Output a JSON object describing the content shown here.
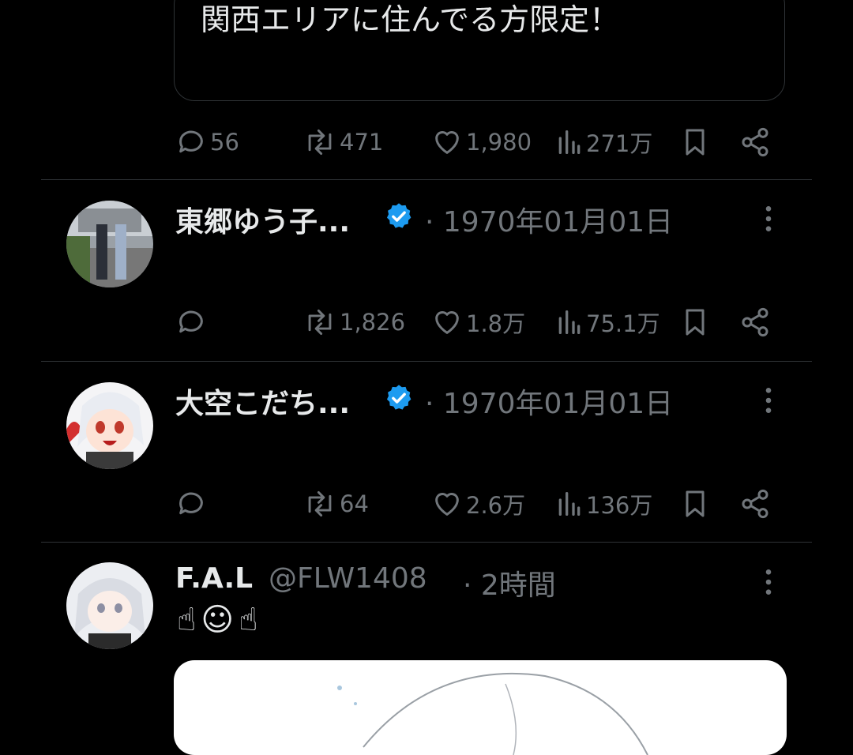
{
  "quote": {
    "text": "関西エリアに住んでる方限定！"
  },
  "tweets": [
    {
      "stats": {
        "replies": "56",
        "retweets": "471",
        "likes": "1,980",
        "views": "271万"
      }
    },
    {
      "name": "東郷ゆう子...",
      "date": "· 1970年01月01日",
      "stats": {
        "replies": "",
        "retweets": "1,826",
        "likes": "1.8万",
        "views": "75.1万"
      }
    },
    {
      "name": "大空こだち...",
      "date": "· 1970年01月01日",
      "stats": {
        "replies": "",
        "retweets": "64",
        "likes": "2.6万",
        "views": "136万"
      }
    },
    {
      "name": "F.A.L",
      "handle": "@FLW1408",
      "time": "· 2時間",
      "emojis": [
        "☝",
        "☺",
        "☝"
      ]
    }
  ],
  "colors": {
    "background": "#000000",
    "text": "#e7e9ea",
    "muted": "#71767b",
    "verified": "#1d9bf0",
    "divider": "#2f3336"
  }
}
